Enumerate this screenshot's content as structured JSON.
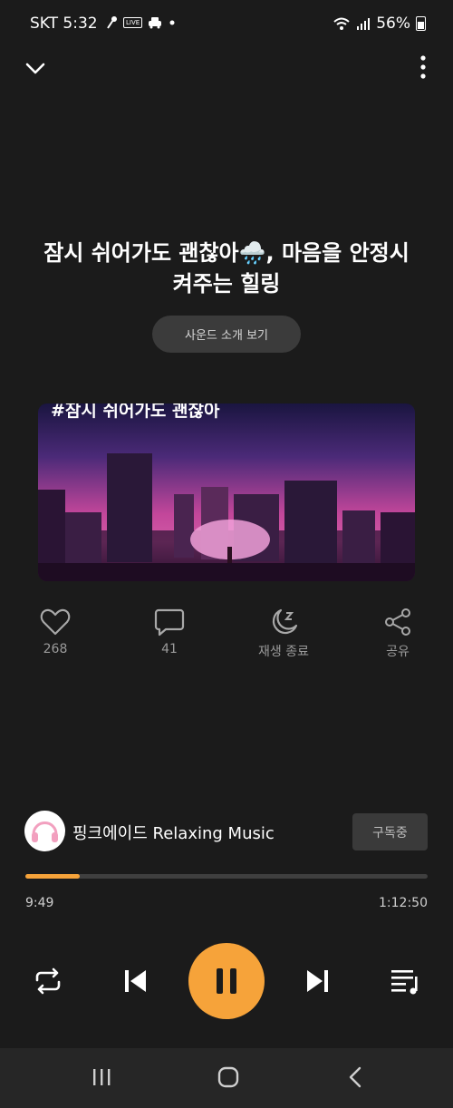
{
  "status_bar": {
    "carrier_time": "SKT 5:32",
    "live_badge": "LIVE",
    "battery": "56%"
  },
  "header": {
    "collapse_icon": "chevron-down-icon",
    "menu_icon": "kebab-menu-icon"
  },
  "track": {
    "title": "잠시 쉬어가도 괜찮아🌧️, 마음을 안정시켜주는 힐링",
    "intro_button": "사운드 소개 보기",
    "thumbnail_text": "#잠시 쉬어가도 괜찮아"
  },
  "actions": [
    {
      "icon": "heart-icon",
      "label": "268"
    },
    {
      "icon": "comment-icon",
      "label": "41"
    },
    {
      "icon": "sleep-timer-icon",
      "label": "재생 종료"
    },
    {
      "icon": "share-icon",
      "label": "공유"
    }
  ],
  "channel": {
    "name": "핑크에이드 Relaxing Music",
    "subscribe_label": "구독중"
  },
  "progress": {
    "elapsed": "9:49",
    "duration": "1:12:50",
    "fraction": 0.135
  },
  "colors": {
    "accent": "#f6a33a",
    "background": "#1b1b1b"
  }
}
